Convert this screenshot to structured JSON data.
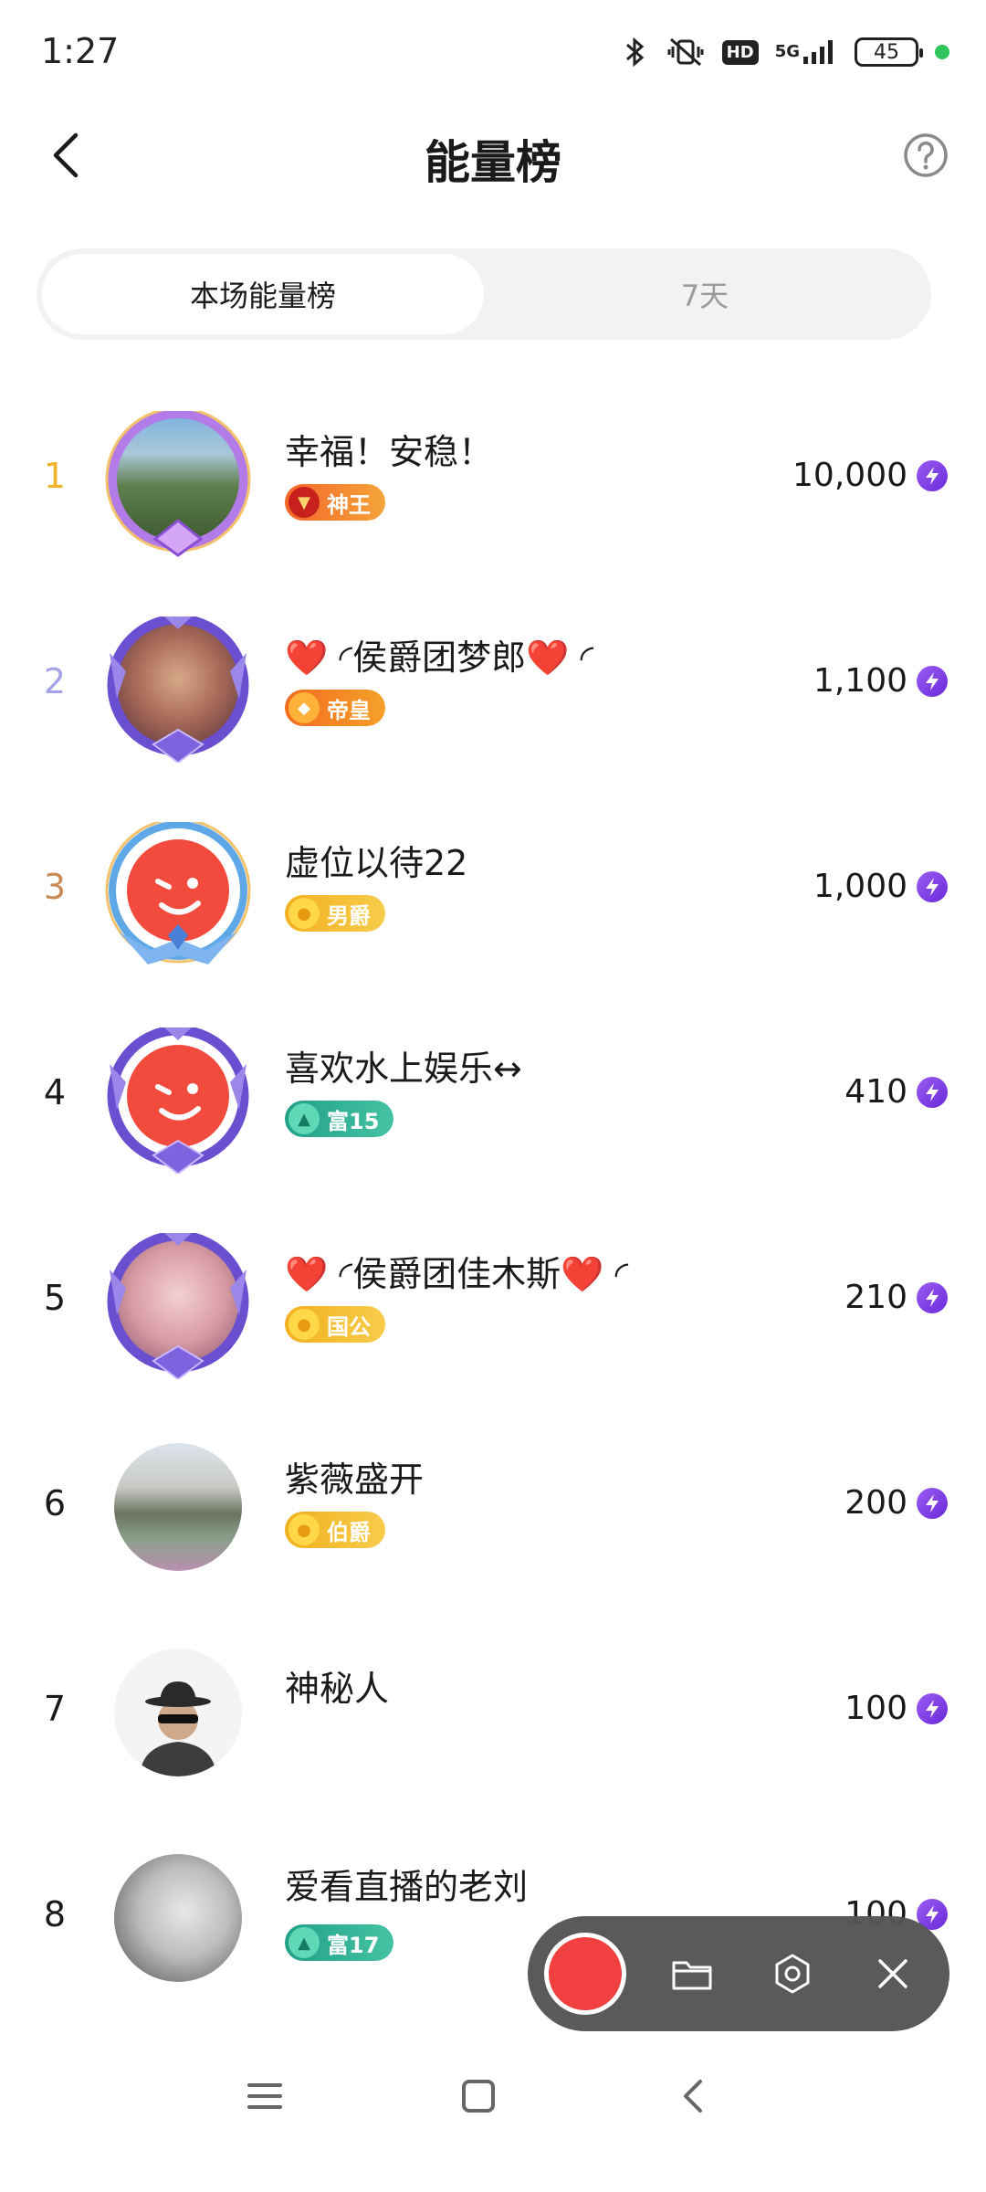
{
  "status_bar": {
    "time": "1:27",
    "icons": [
      "bluetooth-icon",
      "mute-vibrate-icon",
      "hd-icon",
      "5g-signal-icon",
      "battery-icon"
    ],
    "hd_label": "HD",
    "network_label": "5G",
    "battery_level": "45",
    "dot_color": "#2fc55b"
  },
  "header": {
    "title": "能量榜"
  },
  "tabs": [
    {
      "label": "本场能量榜",
      "active": true
    },
    {
      "label": "7天",
      "active": false
    }
  ],
  "rankings": [
    {
      "rank": "1",
      "rank_color": "#f0b429",
      "name": "幸福！安稳！",
      "badge": "神王",
      "badge_color": "#f07a2a",
      "score": "10,000"
    },
    {
      "rank": "2",
      "rank_color": "#a7a2e8",
      "name": "❤️ ◜侯爵团梦郎❤️ ◜",
      "badge": "帝皇",
      "badge_color": "#f08a1a",
      "score": "1,100"
    },
    {
      "rank": "3",
      "rank_color": "#c98a55",
      "name": "虚位以待22",
      "badge": "男爵",
      "badge_color": "#e8a81c",
      "score": "1,000"
    },
    {
      "rank": "4",
      "rank_color": "#1a1a1a",
      "name": "喜欢水上娱乐↔",
      "badge": "富15",
      "badge_color": "#2fa58a",
      "score": "410"
    },
    {
      "rank": "5",
      "rank_color": "#1a1a1a",
      "name": "❤️ ◜侯爵团佳木斯❤️ ◜",
      "badge": "国公",
      "badge_color": "#e8a81c",
      "score": "210"
    },
    {
      "rank": "6",
      "rank_color": "#1a1a1a",
      "name": "紫薇盛开",
      "badge": "伯爵",
      "badge_color": "#e8a81c",
      "score": "200"
    },
    {
      "rank": "7",
      "rank_color": "#1a1a1a",
      "name": "神秘人",
      "badge": "",
      "badge_color": "",
      "score": "100"
    },
    {
      "rank": "8",
      "rank_color": "#1a1a1a",
      "name": "爱看直播的老刘",
      "badge": "富17",
      "badge_color": "#2fa58a",
      "score": "100"
    }
  ],
  "recorder": {
    "buttons": [
      "record-button",
      "folder-icon",
      "settings-icon",
      "close-icon"
    ]
  },
  "navbar": {
    "buttons": [
      "menu-icon",
      "home-icon",
      "back-icon"
    ]
  },
  "colors": {
    "energy_icon": "#7b3ae6",
    "recorder_bg": "#555555",
    "record_red": "#f03a3a"
  }
}
